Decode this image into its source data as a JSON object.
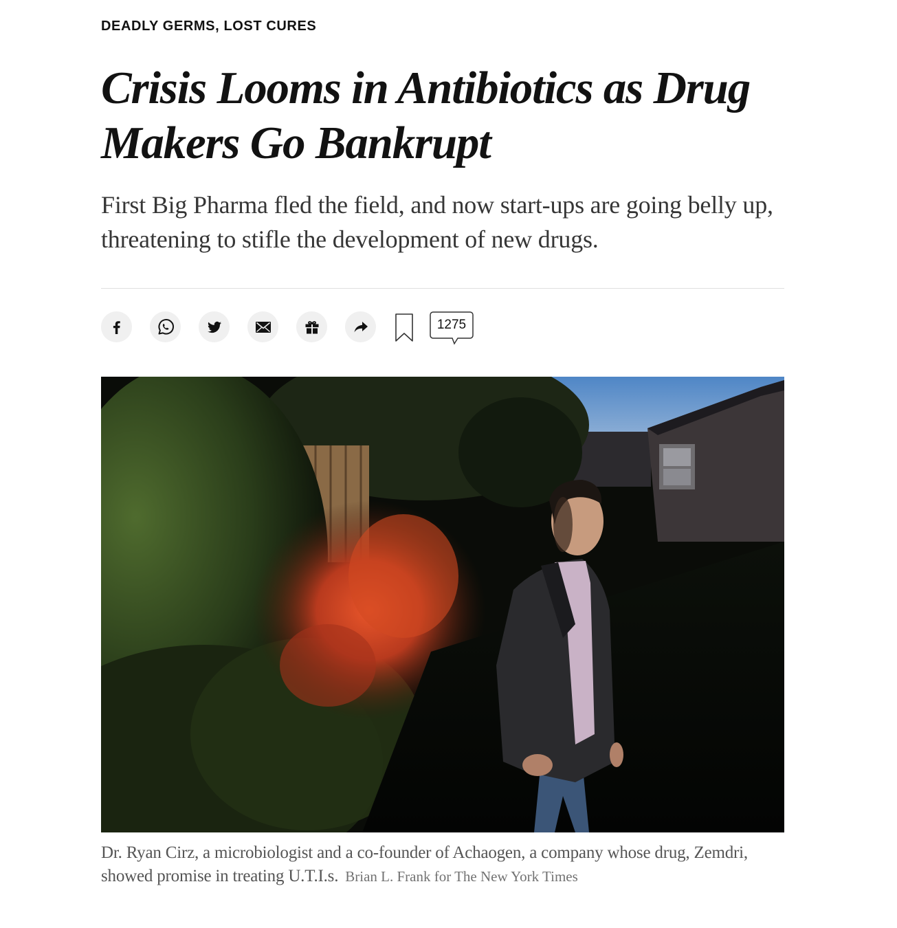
{
  "kicker": "DEADLY GERMS, LOST CURES",
  "headline": {
    "line1": "Crisis Looms in Antibiotics as Drug",
    "line2": "Makers Go Bankrupt"
  },
  "summary": "First Big Pharma fled the field, and now start-ups are going belly up, threatening to stifle the development of new drugs.",
  "share": {
    "buttons": [
      "facebook-icon",
      "whatsapp-icon",
      "twitter-icon",
      "email-icon",
      "gift-icon",
      "share-arrow-icon"
    ],
    "bookmark_icon": "bookmark-icon",
    "comment_count": "1275"
  },
  "photo": {
    "caption": "Dr. Ryan Cirz, a microbiologist and a co-founder of Achaogen, a company whose drug, Zemdri, showed promise in treating U.T.I.s.",
    "credit": "Brian L. Frank for The New York Times"
  },
  "colors": {
    "text": "#121212",
    "summary_text": "#363636",
    "caption_text": "#555555",
    "credit_text": "#727272",
    "button_bg": "#f0f0f0",
    "rule": "#dfdfdf"
  }
}
